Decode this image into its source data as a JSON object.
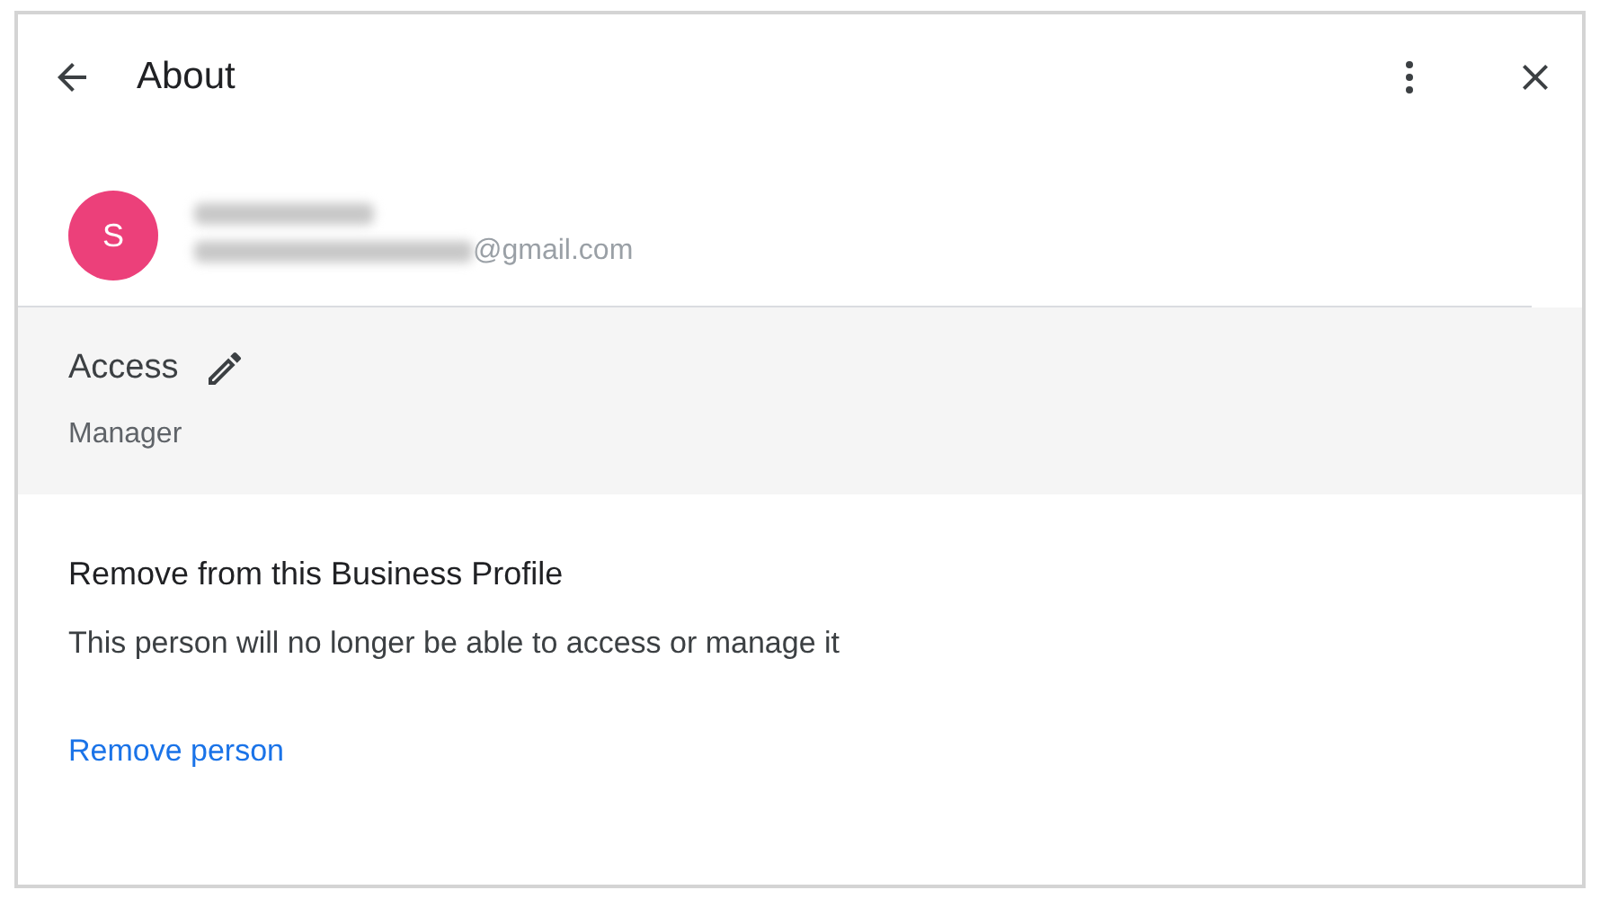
{
  "header": {
    "title": "About"
  },
  "user": {
    "initial": "S",
    "email_visible": "@gmail.com"
  },
  "access": {
    "label": "Access",
    "role": "Manager"
  },
  "remove": {
    "heading": "Remove from this Business Profile",
    "description": "This person will no longer be able to access or manage it",
    "link": "Remove person"
  }
}
